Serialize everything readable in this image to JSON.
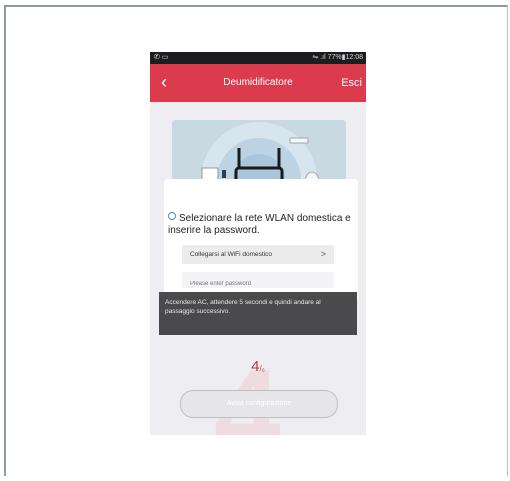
{
  "status_bar": {
    "left_icons": "✆ ▭",
    "right": "⇋ .ıl 77%▮12:08"
  },
  "app_bar": {
    "title": "Deumidificatore",
    "exit_label": "Esci",
    "back_icon": "chevron-left-icon"
  },
  "setup": {
    "instruction": "Selezionare la rete WLAN domestica e inserire la password.",
    "wifi_row_label": "Collegarsi al WiFi domestico",
    "wifi_row_chevron": ">",
    "password_placeholder": "Please enter password",
    "tooltip_text": "Accendere AC, attendere 5 secondi e quindi andare al passaggio successivo.",
    "step_current": "4",
    "step_total": "/₆",
    "start_button_label": "Avvia configurazione"
  },
  "colors": {
    "accent_red": "#dc3b4e",
    "illustration_bg": "#c9d9e2",
    "tooltip_bg": "#4a4a4c"
  }
}
